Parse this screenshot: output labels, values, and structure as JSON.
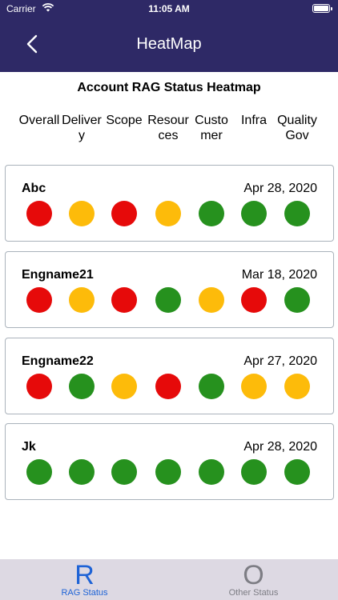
{
  "status_bar": {
    "carrier": "Carrier",
    "time": "11:05 AM"
  },
  "nav": {
    "title": "HeatMap",
    "back_icon": "chevron-left-icon"
  },
  "heatmap": {
    "title": "Account RAG Status Heatmap",
    "columns": [
      [
        "Overall",
        ""
      ],
      [
        "Deliver",
        "y"
      ],
      [
        "Scope",
        ""
      ],
      [
        "Resour",
        "ces"
      ],
      [
        "Custo",
        "mer"
      ],
      [
        "Infra",
        ""
      ],
      [
        "Quality",
        "Gov"
      ]
    ]
  },
  "colors": {
    "red": "#e60a0a",
    "yellow": "#fdbb0a",
    "green": "#26911e"
  },
  "accounts": [
    {
      "name": "Abc",
      "date": "Apr 28, 2020",
      "statuses": [
        "red",
        "yellow",
        "red",
        "yellow",
        "green",
        "green",
        "green"
      ]
    },
    {
      "name": "Engname21",
      "date": "Mar 18, 2020",
      "statuses": [
        "red",
        "yellow",
        "red",
        "green",
        "yellow",
        "red",
        "green"
      ]
    },
    {
      "name": "Engname22",
      "date": "Apr 27, 2020",
      "statuses": [
        "red",
        "green",
        "yellow",
        "red",
        "green",
        "yellow",
        "yellow"
      ]
    },
    {
      "name": "Jk",
      "date": "Apr 28, 2020",
      "statuses": [
        "green",
        "green",
        "green",
        "green",
        "green",
        "green",
        "green"
      ]
    }
  ],
  "tabbar": {
    "tabs": [
      {
        "icon_letter": "R",
        "label": "RAG Status"
      },
      {
        "icon_letter": "O",
        "label": "Other Status"
      }
    ]
  }
}
